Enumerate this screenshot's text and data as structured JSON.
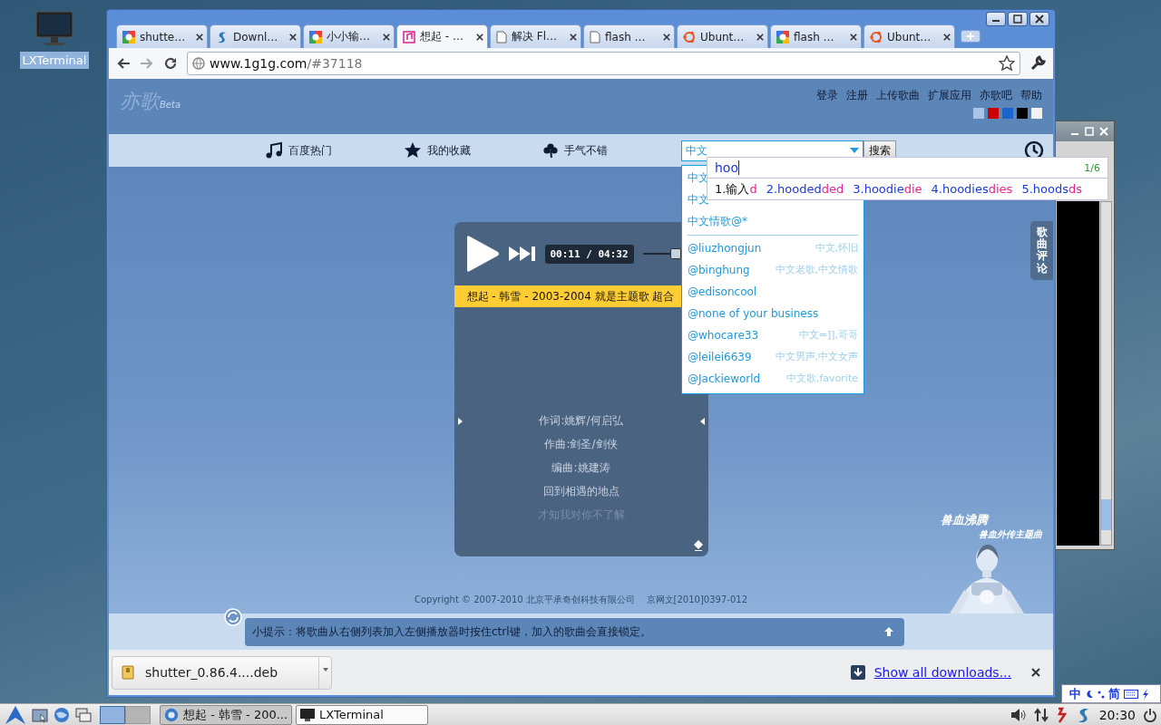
{
  "desktop": {
    "icons": [
      {
        "label": "LXTerminal",
        "selected": true
      }
    ]
  },
  "browser": {
    "tabs": [
      {
        "title": "shutte…",
        "kind": "google",
        "selected": false
      },
      {
        "title": "Downl…",
        "kind": "swirl",
        "selected": false
      },
      {
        "title": "小小输…",
        "kind": "google",
        "selected": false
      },
      {
        "title": "想起 - …",
        "kind": "music",
        "selected": true
      },
      {
        "title": "解决 Fl…",
        "kind": "page",
        "selected": false
      },
      {
        "title": "flash …",
        "kind": "page",
        "selected": false
      },
      {
        "title": "Ubunt…",
        "kind": "ubuntu",
        "selected": false
      },
      {
        "title": "flash …",
        "kind": "google",
        "selected": false
      },
      {
        "title": "Ubunt…",
        "kind": "ubuntu",
        "selected": false
      }
    ],
    "address": {
      "host": "www.1g1g.com",
      "path": "/#37118"
    }
  },
  "page": {
    "logo": "亦歌",
    "logo_suffix": "Beta",
    "top_links": [
      "登录",
      "注册",
      "上传歌曲",
      "扩展应用",
      "亦歌吧",
      "帮助"
    ],
    "theme_colors": [
      {
        "color": "#a9c4e8"
      },
      {
        "color": "#cc0000"
      },
      {
        "color": "#1a66cc"
      },
      {
        "color": "#000000"
      },
      {
        "color": "#f2f2f2"
      }
    ],
    "nav": [
      {
        "label": "百度热门",
        "kind": "music"
      },
      {
        "label": "我的收藏",
        "kind": "star"
      },
      {
        "label": "手气不错",
        "kind": "clover"
      }
    ],
    "search": {
      "value": "中文",
      "button": "搜索"
    },
    "suggestions": {
      "queries": [
        "中文",
        "中文",
        "中文情歌@*"
      ],
      "users": [
        {
          "name": "@liuzhongjun",
          "tags": "中文,怀旧"
        },
        {
          "name": "@binghung",
          "tags": "中文老歌,中文情歌"
        },
        {
          "name": "@edisoncool"
        },
        {
          "name": "@none of your business"
        },
        {
          "name": "@whocare33",
          "tags": "中文=]],哥哥"
        },
        {
          "name": "@leilei6639",
          "tags": "中文男声,中文女声"
        },
        {
          "name": "@Jackieworld",
          "tags": "中文歌,favorite"
        }
      ]
    },
    "player": {
      "time": "00:11 / 04:32",
      "volume": {
        "level": 1
      },
      "ticker": "想起 - 韩雪 - 2003-2004 就是主题歌 超合",
      "lyrics": [
        {
          "text": "作词:姚辉/何启弘",
          "faded": false
        },
        {
          "text": "作曲:剑圣/剑侠",
          "faded": false
        },
        {
          "text": "编曲:姚建涛",
          "faded": false
        },
        {
          "text": "回到相遇的地点",
          "faded": false
        },
        {
          "text": "才知我对你不了解",
          "faded": true
        }
      ]
    },
    "side_tab": "歌曲评论",
    "promo": {
      "title": "兽血沸腾",
      "subtitle": "兽血外传主题曲"
    },
    "copyright": "Copyright © 2007-2010 北京平承奇创科技有限公司    京网文[2010]0397-012",
    "tip": "小提示：将歌曲从右侧列表加入左侧播放器时按住ctrl键，加入的歌曲会直接锁定。"
  },
  "downloads": {
    "file": "shutter_0.86.4....deb",
    "show_all": "Show all downloads..."
  },
  "ime": {
    "input": "hoo",
    "page": "1/6",
    "candidates": [
      {
        "text": "1.输入",
        "completion": "d",
        "selected": true
      },
      {
        "text": "2.hooded",
        "completion": "ded",
        "selected": false
      },
      {
        "text": "3.hoodie",
        "completion": "die",
        "selected": false
      },
      {
        "text": "4.hoodies",
        "completion": "dies",
        "selected": false
      },
      {
        "text": "5.hoods",
        "completion": "ds",
        "selected": false
      }
    ],
    "status": [
      "中",
      "简"
    ]
  },
  "taskbar": {
    "desktops": [
      {
        "selected": true
      },
      {
        "selected": false
      }
    ],
    "tasks": [
      {
        "label": "想起 - 韩雪 - 200...",
        "kind": "browser",
        "selected": true
      },
      {
        "label": "LXTerminal",
        "kind": "terminal",
        "selected": false
      }
    ],
    "clock": "20:30"
  }
}
